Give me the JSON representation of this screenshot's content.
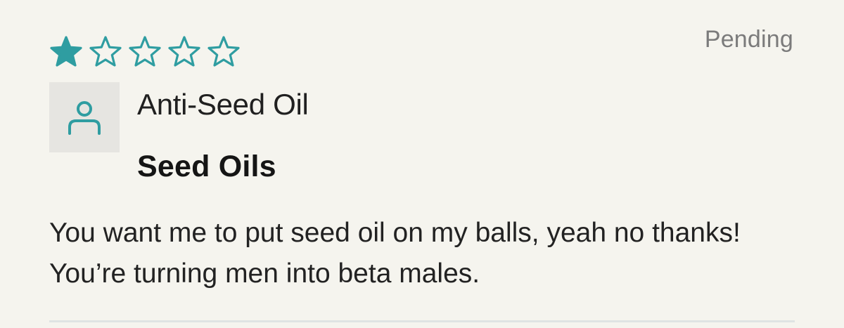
{
  "review": {
    "rating": 1,
    "max_rating": 5,
    "status": "Pending",
    "author": "Anti-Seed Oil",
    "title": "Seed Oils",
    "body": "You want me to put seed oil on my balls, yeah no thanks! You’re turning men into beta males."
  },
  "icons": {
    "avatar": "user-icon",
    "filled_star": "star-filled-icon",
    "empty_star": "star-outline-icon"
  },
  "colors": {
    "background": "#f5f4ee",
    "accent": "#2f9da1",
    "avatar_background": "#e6e5e1",
    "status_text": "#7b7b7b",
    "divider": "#dfe3e3"
  }
}
